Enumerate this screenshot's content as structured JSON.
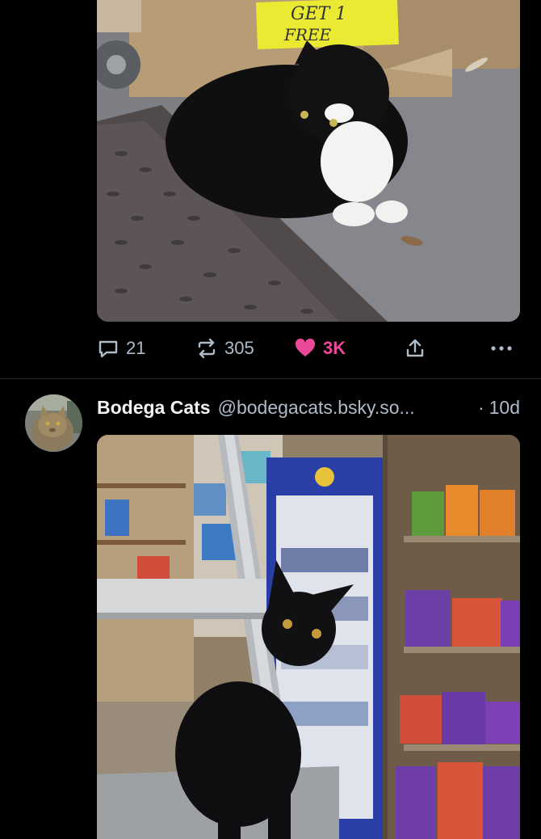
{
  "feed": {
    "post_1": {
      "image_sign_text": "GET 1 FREE",
      "counts": {
        "replies": "21",
        "reposts": "305",
        "likes": "3K"
      },
      "liked": true
    },
    "post_2": {
      "author": {
        "display_name": "Bodega Cats",
        "handle": "@bodegacats.bsky.so..."
      },
      "separator": "·",
      "timestamp": "10d"
    }
  },
  "colors": {
    "background": "#000000",
    "text_primary": "#f1f3f5",
    "text_secondary": "#aebbc9",
    "like_active": "#ec4899",
    "divider": "#1e2936"
  },
  "icons": {
    "reply": "speech-bubble-icon",
    "repost": "repost-arrows-icon",
    "like": "heart-icon",
    "share": "share-upload-icon",
    "more": "ellipsis-icon"
  }
}
